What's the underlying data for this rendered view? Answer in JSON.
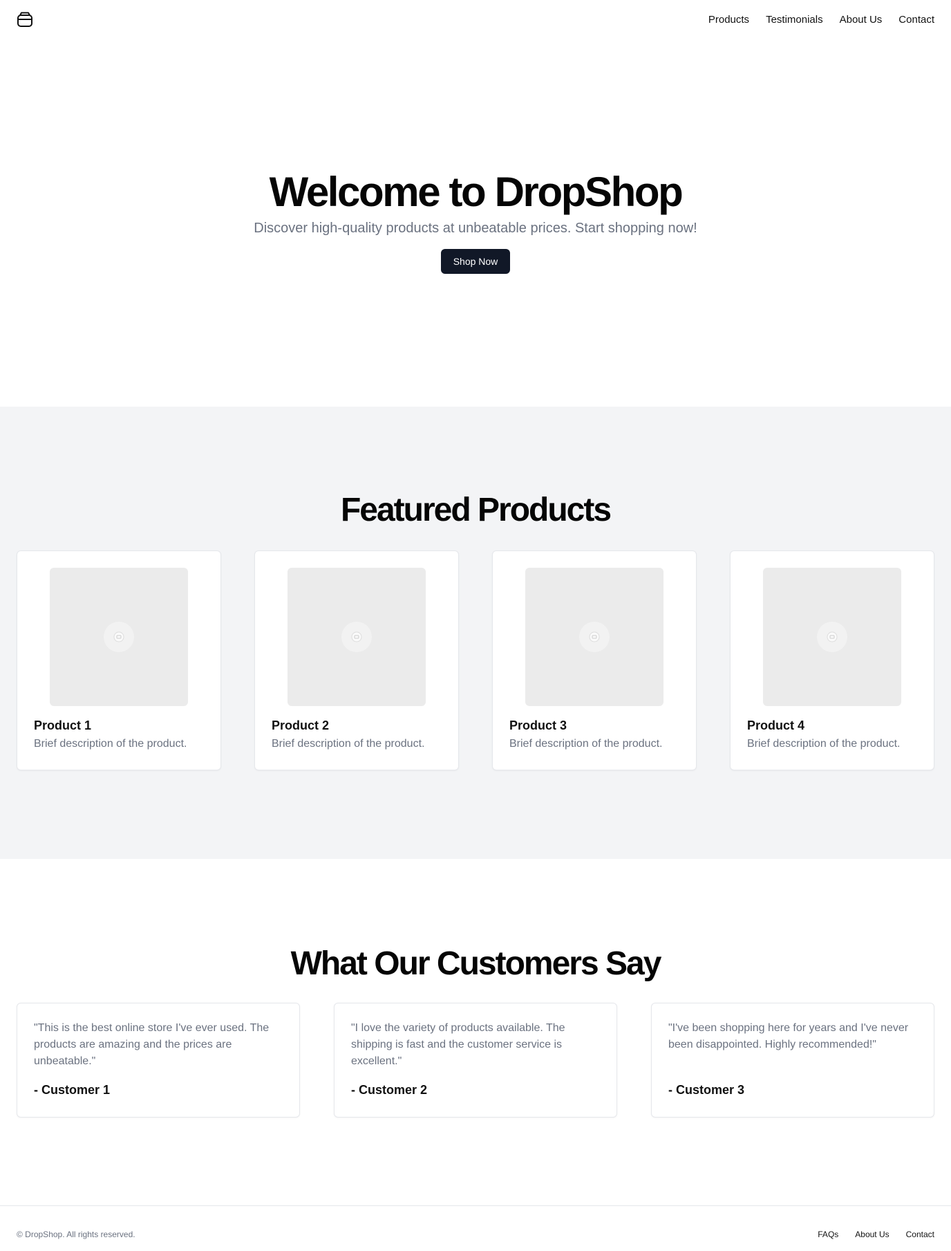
{
  "header": {
    "logo_icon": "package-icon",
    "nav": [
      {
        "label": "Products"
      },
      {
        "label": "Testimonials"
      },
      {
        "label": "About Us"
      },
      {
        "label": "Contact"
      }
    ]
  },
  "hero": {
    "title": "Welcome to DropShop",
    "subtitle": "Discover high-quality products at unbeatable prices. Start shopping now!",
    "cta_label": "Shop Now"
  },
  "featured": {
    "title": "Featured Products",
    "products": [
      {
        "name": "Product 1",
        "description": "Brief description of the product."
      },
      {
        "name": "Product 2",
        "description": "Brief description of the product."
      },
      {
        "name": "Product 3",
        "description": "Brief description of the product."
      },
      {
        "name": "Product 4",
        "description": "Brief description of the product."
      }
    ]
  },
  "testimonials": {
    "title": "What Our Customers Say",
    "items": [
      {
        "quote": "\"This is the best online store I've ever used. The products are amazing and the prices are unbeatable.\"",
        "author": "- Customer 1"
      },
      {
        "quote": "\"I love the variety of products available. The shipping is fast and the customer service is excellent.\"",
        "author": "- Customer 2"
      },
      {
        "quote": "\"I've been shopping here for years and I've never been disappointed. Highly recommended!\"",
        "author": "- Customer 3"
      }
    ]
  },
  "footer": {
    "copyright": "© DropShop. All rights reserved.",
    "links": [
      {
        "label": "FAQs"
      },
      {
        "label": "About Us"
      },
      {
        "label": "Contact"
      }
    ]
  },
  "colors": {
    "accent_button": "#111827",
    "muted_text": "#6b7280",
    "section_background": "#f3f4f6"
  }
}
